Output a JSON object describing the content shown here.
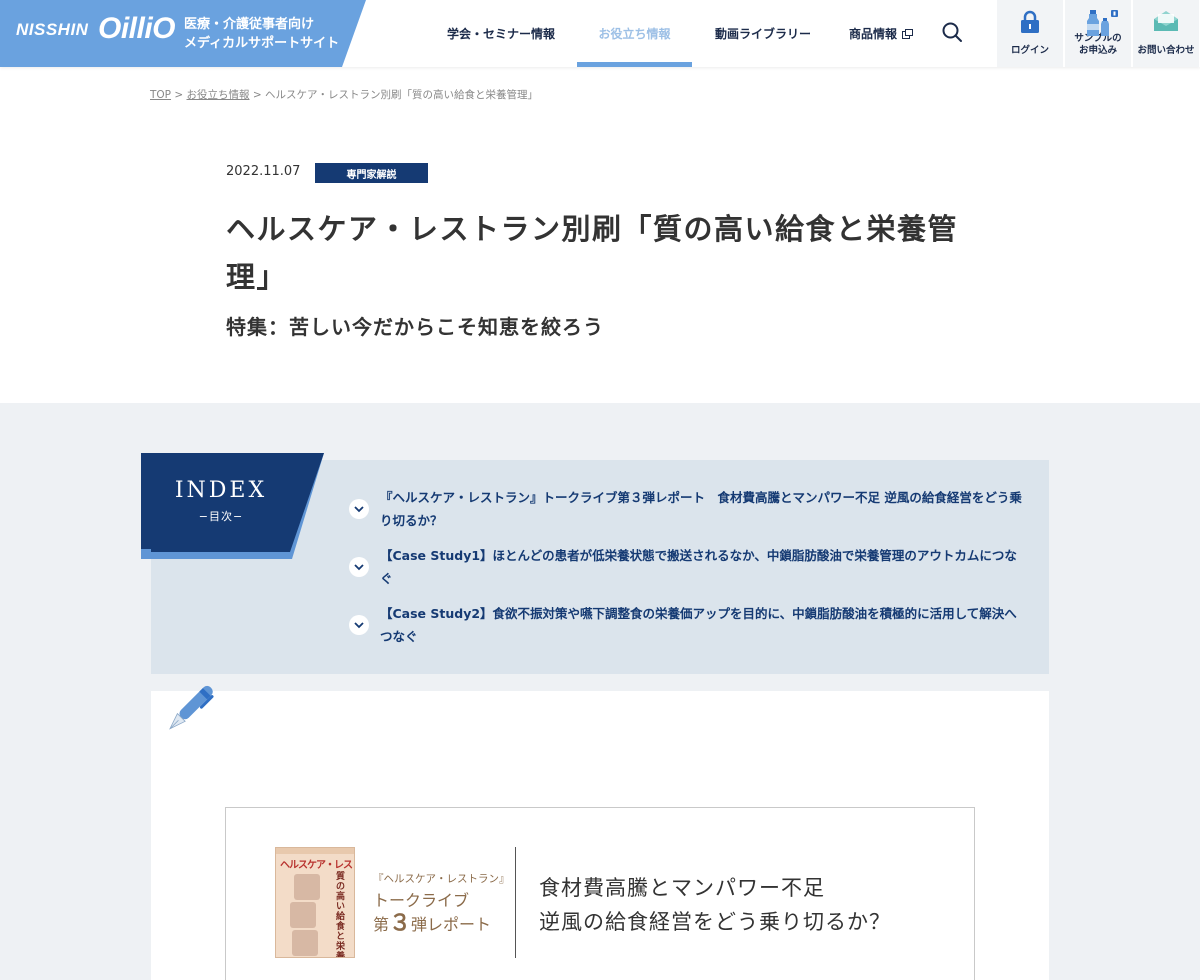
{
  "header": {
    "logo_nisshin": "NISSHIN",
    "logo_oillio": "OilliO",
    "tagline_1": "医療・介護従事者向け",
    "tagline_2": "メディカルサポートサイト",
    "nav": [
      {
        "label": "学会・セミナー情報",
        "active": false
      },
      {
        "label": "お役立ち情報",
        "active": true
      },
      {
        "label": "動画ライブラリー",
        "active": false
      },
      {
        "label": "商品情報",
        "active": false,
        "external": true
      }
    ],
    "buttons": {
      "login": "ログイン",
      "sample_1": "サンプルの",
      "sample_2": "お申込み",
      "contact": "お問い合わせ"
    },
    "colors": {
      "brand": "#6aa2df",
      "navy": "#153a73"
    }
  },
  "breadcrumb": {
    "top": "TOP",
    "sep": " > ",
    "parent": "お役立ち情報",
    "current": "ヘルスケア・レストラン別刷「質の高い給食と栄養管理」"
  },
  "article": {
    "date": "2022.11.07",
    "category": "専門家解説",
    "title": "ヘルスケア・レストラン別刷「質の高い給食と栄養管理」",
    "subtitle": "特集：苦しい今だからこそ知恵を絞ろう"
  },
  "index": {
    "title": "INDEX",
    "sub": "−目次−",
    "items": [
      "『ヘルスケア・レストラン』トークライブ第３弾レポート　食材費高騰とマンパワー不足 逆風の給食経営をどう乗り切るか？",
      "【Case Study1】ほとんどの患者が低栄養状態で搬送されるなか、中鎖脂肪酸油で栄養管理のアウトカムにつなぐ",
      "【Case Study2】食欲不振対策や嚥下調整食の栄養価アップを目的に、中鎖脂肪酸油を積極的に活用して解決へつなぐ"
    ]
  },
  "feature": {
    "magazine_title": "ヘルスケア・レストラン",
    "magazine_vertical": "質の高い給食と栄養管理",
    "left_small": "『ヘルスケア・レストラン』",
    "left_line1": "トークライブ",
    "left_line2_pre": "第",
    "left_line2_num": "３",
    "left_line2_post": "弾レポート",
    "right_line1": "食材費高騰とマンパワー不足",
    "right_line2": "逆風の給食経営をどう乗り切るか？"
  }
}
